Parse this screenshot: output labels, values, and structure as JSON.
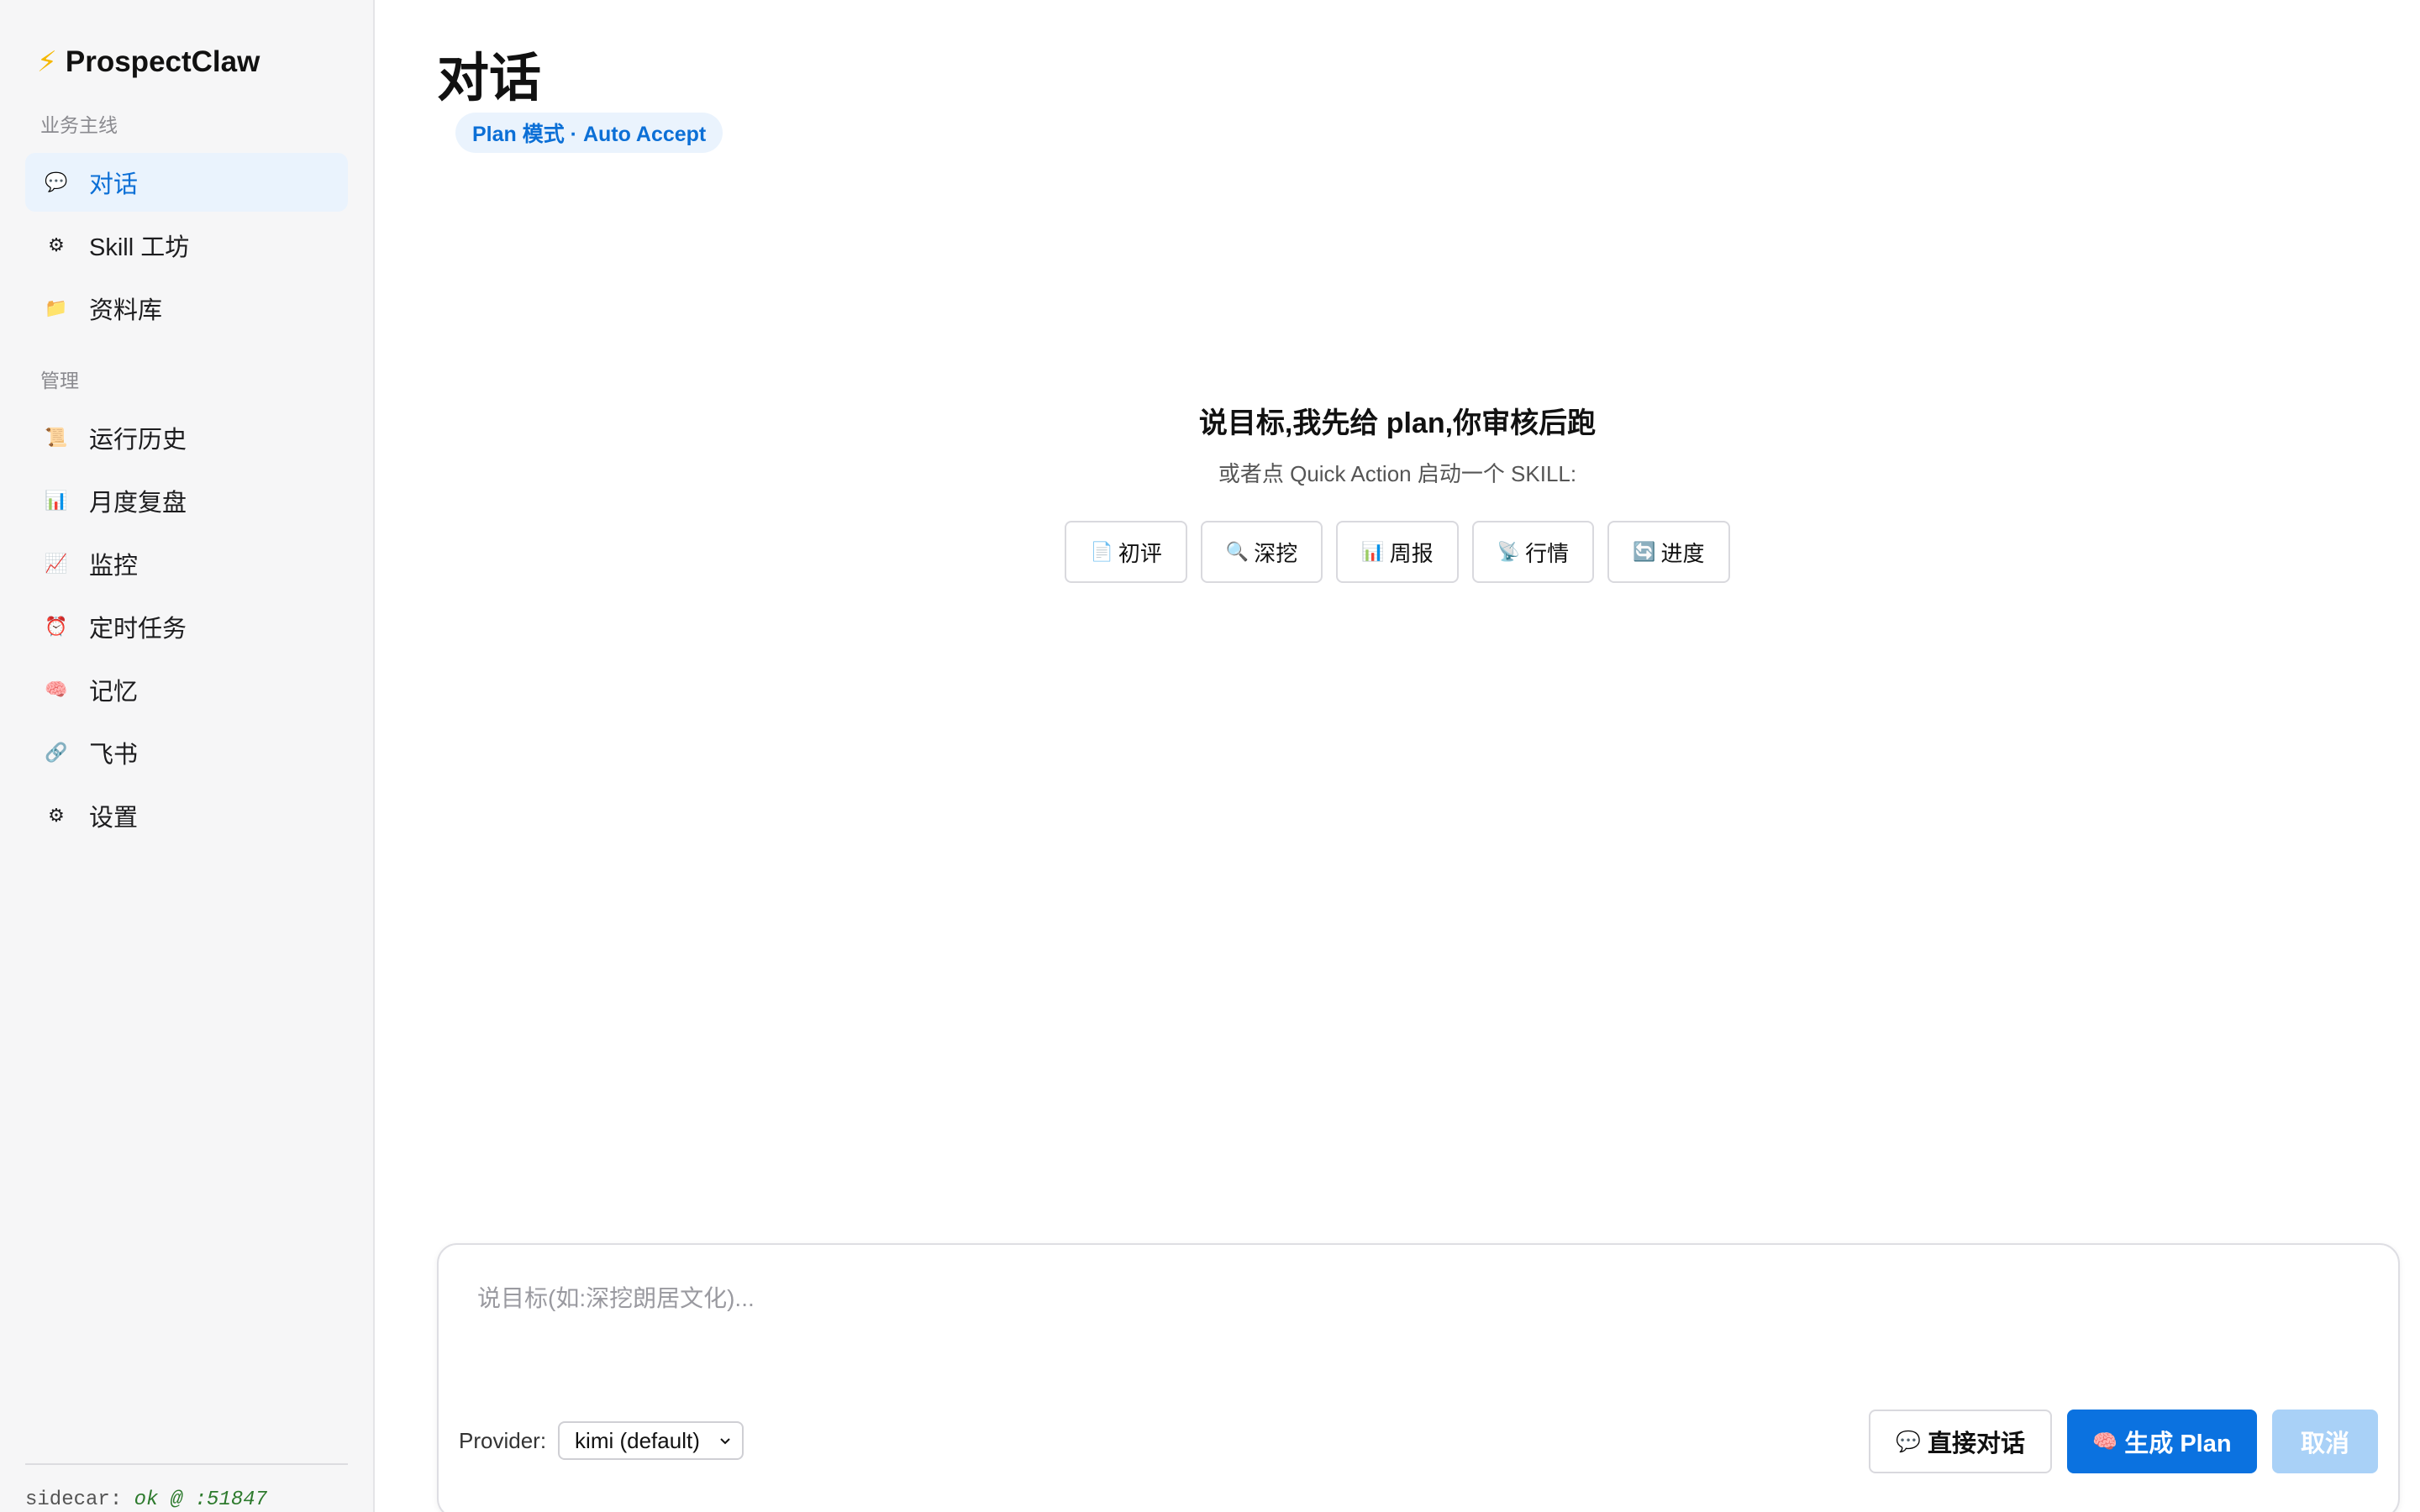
{
  "brand": {
    "icon": "lightning-icon",
    "name": "ProspectClaw"
  },
  "sidebar": {
    "section_business": "业务主线",
    "section_admin": "管理",
    "business_items": [
      {
        "icon": "speech-bubble-icon",
        "glyph": "💬",
        "label": "对话",
        "active": true
      },
      {
        "icon": "gear-icon",
        "glyph": "⚙",
        "label": "Skill 工坊",
        "active": false
      },
      {
        "icon": "folder-icon",
        "glyph": "📁",
        "label": "资料库",
        "active": false
      }
    ],
    "admin_items": [
      {
        "icon": "scroll-icon",
        "glyph": "📜",
        "label": "运行历史"
      },
      {
        "icon": "bar-chart-icon",
        "glyph": "📊",
        "label": "月度复盘"
      },
      {
        "icon": "trend-chart-icon",
        "glyph": "📈",
        "label": "监控"
      },
      {
        "icon": "alarm-clock-icon",
        "glyph": "⏰",
        "label": "定时任务"
      },
      {
        "icon": "brain-icon",
        "glyph": "🧠",
        "label": "记忆"
      },
      {
        "icon": "link-icon",
        "glyph": "🔗",
        "label": "飞书"
      },
      {
        "icon": "gear-icon",
        "glyph": "⚙",
        "label": "设置"
      }
    ],
    "footer": {
      "prefix": "sidecar:",
      "status": "ok @ :51847"
    }
  },
  "main": {
    "title": "对话",
    "mode_badge": "Plan 模式 · Auto Accept",
    "empty_title": "说目标,我先给 plan,你审核后跑",
    "empty_subtitle": "或者点 Quick Action 启动一个 SKILL:",
    "quick_actions": [
      {
        "icon": "document-icon",
        "glyph": "📄",
        "label": "初评"
      },
      {
        "icon": "magnifier-icon",
        "glyph": "🔍",
        "label": "深挖"
      },
      {
        "icon": "bar-chart-icon",
        "glyph": "📊",
        "label": "周报"
      },
      {
        "icon": "satellite-icon",
        "glyph": "📡",
        "label": "行情"
      },
      {
        "icon": "refresh-icon",
        "glyph": "🔄",
        "label": "进度"
      }
    ]
  },
  "composer": {
    "placeholder": "说目标(如:深挖朗居文化)...",
    "value": "",
    "provider_label": "Provider:",
    "provider_selected": "kimi (default)",
    "direct_chat_label": "直接对话",
    "direct_chat_icon": "speech-bubble-icon",
    "generate_plan_label": "生成 Plan",
    "generate_plan_icon": "brain-icon",
    "cancel_label": "取消"
  },
  "colors": {
    "accent": "#0b72e0",
    "accent_soft": "#eaf3fd",
    "disabled": "#a9d1f7",
    "sidebar_bg": "#f6f6f7"
  }
}
